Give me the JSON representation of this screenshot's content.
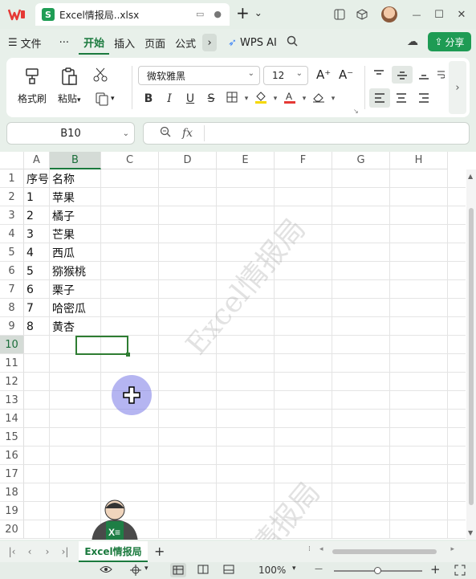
{
  "app": {
    "name": "WPS Office",
    "logo_text": "W"
  },
  "document_tab": {
    "badge": "S",
    "title": "Excel情报局..xlsx"
  },
  "titlebar": {
    "new_tab": "+",
    "new_tab_caret": "⌄",
    "min": "—",
    "max": "☐",
    "close": "✕"
  },
  "menu": {
    "hamburger": "☰",
    "file": "文件",
    "more": "···",
    "items": [
      "开始",
      "插入",
      "页面",
      "公式"
    ],
    "active": "开始",
    "chevron": "›",
    "wps_ai": "WPS AI",
    "share": "分享"
  },
  "ribbon": {
    "format_painter": "格式刷",
    "paste": "粘贴",
    "paste_caret": "▾",
    "font_name": "微软雅黑",
    "font_size": "12",
    "increase_font": "A⁺",
    "decrease_font": "A⁻",
    "bold": "B",
    "italic": "I",
    "underline": "U",
    "strike": "S",
    "more_arrow": "›"
  },
  "formula_bar": {
    "cell_ref": "B10",
    "fx": "fx",
    "formula": ""
  },
  "sheet": {
    "columns": [
      "A",
      "B",
      "C",
      "D",
      "E",
      "F",
      "G",
      "H"
    ],
    "selected_column": "B",
    "rows": [
      "1",
      "2",
      "3",
      "4",
      "5",
      "6",
      "7",
      "8",
      "9",
      "10",
      "11",
      "12",
      "13",
      "14",
      "15",
      "16",
      "17",
      "18",
      "19",
      "20"
    ],
    "selected_row": "10",
    "data": [
      [
        "序号",
        "名称"
      ],
      [
        "1",
        "苹果"
      ],
      [
        "2",
        "橘子"
      ],
      [
        "3",
        "芒果"
      ],
      [
        "4",
        "西瓜"
      ],
      [
        "5",
        "猕猴桃"
      ],
      [
        "6",
        "栗子"
      ],
      [
        "7",
        "哈密瓜"
      ],
      [
        "8",
        "黄杏"
      ]
    ],
    "watermark": "Excel情报局",
    "watermark_partial": "情报局",
    "mascot_label": "X≡"
  },
  "sheet_tabs": {
    "tabs": [
      "Excel情报局"
    ],
    "active": "Excel情报局",
    "add": "+"
  },
  "status_bar": {
    "zoom": "100%",
    "zoom_minus": "—",
    "zoom_plus": "+"
  },
  "colors": {
    "accent": "#1b7a3e",
    "share_button": "#1e9b54",
    "logo": "#e53935",
    "selection": "#2e7d32"
  }
}
